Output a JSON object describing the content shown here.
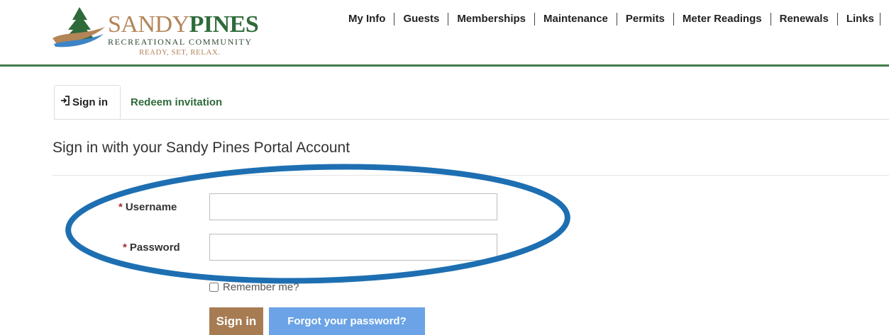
{
  "brand": {
    "name_part1": "SANDY",
    "name_part2": "PINES",
    "subtitle": "RECREATIONAL COMMUNITY",
    "tagline": "READY, SET, RELAX."
  },
  "nav": {
    "items": [
      {
        "label": "My Info"
      },
      {
        "label": "Guests"
      },
      {
        "label": "Memberships"
      },
      {
        "label": "Maintenance"
      },
      {
        "label": "Permits"
      },
      {
        "label": "Meter Readings"
      },
      {
        "label": "Renewals"
      },
      {
        "label": "Links"
      }
    ]
  },
  "tabs": {
    "signin_label": "Sign in",
    "redeem_label": "Redeem invitation",
    "signin_icon": "sign-in-icon"
  },
  "form": {
    "heading": "Sign in with your Sandy Pines Portal Account",
    "required_mark": "*",
    "username_label": "Username",
    "username_value": "",
    "password_label": "Password",
    "password_value": "",
    "remember_label": "Remember me?",
    "signin_button": "Sign in",
    "forgot_button": "Forgot your password?"
  },
  "colors": {
    "brand_green": "#2f6b3a",
    "brand_tan": "#a77c53",
    "link_blue": "#6ba3e6",
    "annotation_blue": "#1e6fb2",
    "required_red": "#a0312a"
  }
}
